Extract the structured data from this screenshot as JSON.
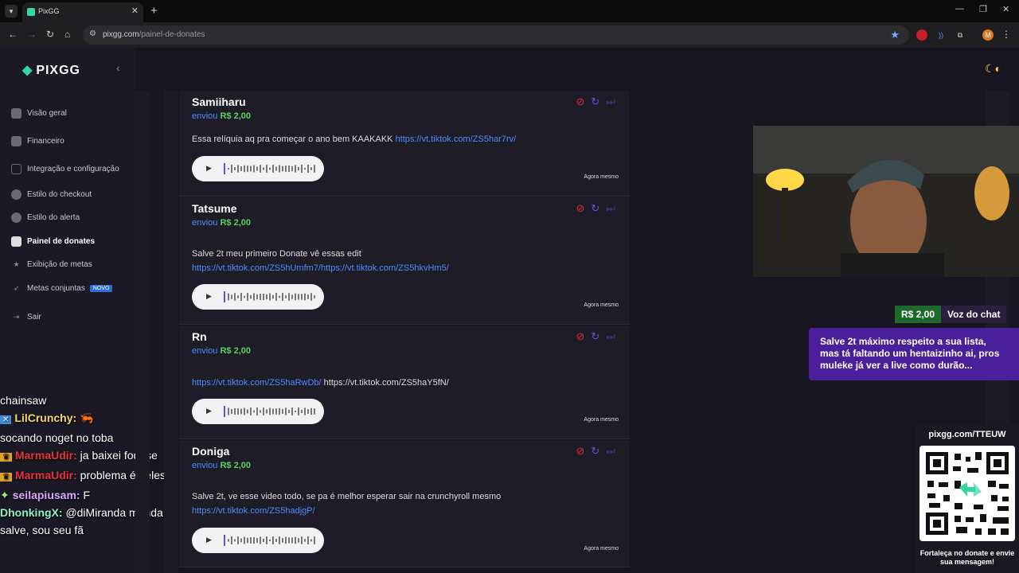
{
  "browser": {
    "tab_title": "PixGG",
    "url_host": "pixgg.com",
    "url_path": "/painel-de-donates",
    "profile_initial": "M"
  },
  "sidebar": {
    "logo": "PIXGG",
    "items": [
      {
        "label": "Visão geral",
        "icon": "home-icon"
      },
      {
        "label": "Financeiro",
        "icon": "wallet-icon"
      },
      {
        "label": "Integração e configuração",
        "icon": "settings-icon"
      },
      {
        "label": "Estilo do checkout",
        "icon": "palette-icon"
      },
      {
        "label": "Estilo do alerta",
        "icon": "palette-icon"
      },
      {
        "label": "Painel de donates",
        "icon": "donate-icon"
      },
      {
        "label": "Exibição de metas",
        "icon": "star-icon"
      },
      {
        "label": "Metas conjuntas",
        "icon": "rocket-icon",
        "badge": "NOVO"
      },
      {
        "label": "Sair",
        "icon": "logout-icon"
      }
    ]
  },
  "chat": [
    {
      "user": "",
      "text": "chainsaw",
      "color": "#ffffff"
    },
    {
      "user": "LilCrunchy:",
      "text": "socando noget no toba",
      "color": "#f5d76e"
    },
    {
      "user": "MarmaUdir:",
      "text": "ja baixei fodase",
      "color": "#e8333a"
    },
    {
      "user": "MarmaUdir:",
      "text": "problema é deles",
      "color": "#e8333a"
    },
    {
      "user": "seilapiusam:",
      "text": "F",
      "color": "#d9a6ff"
    },
    {
      "user": "DhonkingX:",
      "text": "@diMiranda manda salve, sou seu fã",
      "color": "#8ef0c0"
    }
  ],
  "donations": [
    {
      "name": "Samiiharu",
      "sent": "enviou",
      "amount": "R$ 2,00",
      "text": "Essa relíquia aq pra começar o ano bem KAAKAKK ",
      "link": "https://vt.tiktok.com/ZS5har7rv/",
      "link2": "",
      "time": "Agora mesmo"
    },
    {
      "name": "Tatsume",
      "sent": "enviou",
      "amount": "R$ 2,00",
      "text": "Salve 2t meu primeiro Donate vê essas edit",
      "link": "https://vt.tiktok.com/ZS5hUmfm7/https://vt.tiktok.com/ZS5hkvHm5/",
      "link2": "",
      "time": "Agora mesmo"
    },
    {
      "name": "Rn",
      "sent": "enviou",
      "amount": "R$ 2,00",
      "text": "",
      "link": "https://vt.tiktok.com/ZS5haRwDb/",
      "link2": " https://vt.tiktok.com/ZS5haY5fN/",
      "time": "Agora mesmo"
    },
    {
      "name": "Doniga",
      "sent": "enviou",
      "amount": "R$ 2,00",
      "text": "Salve 2t, ve esse video todo, se pa é melhor esperar sair na crunchyroll mesmo",
      "link": "https://vt.tiktok.com/ZS5hadjgP/",
      "link2": "",
      "time": "Agora mesmo"
    }
  ],
  "overlay": {
    "amount": "R$ 2,00",
    "voice": "Voz do chat",
    "message": "Salve 2t máximo respeito a sua lista, mas tá faltando um hentaizinho ai, pros muleke já ver a live como durão...",
    "qr_url": "pixgg.com/TTEUW",
    "qr_caption": "Fortaleça no donate e envie sua mensagem!"
  },
  "colors": {
    "accent": "#32d6a0",
    "link": "#4a8cff",
    "amount": "#5ad15a"
  }
}
